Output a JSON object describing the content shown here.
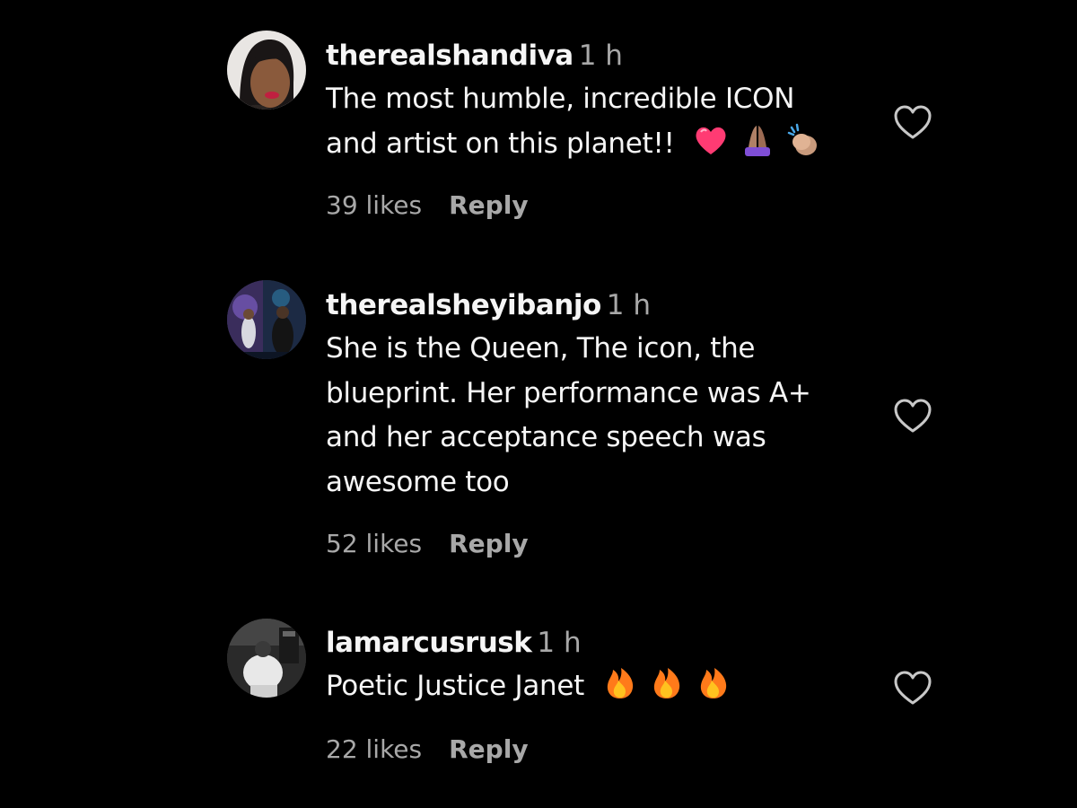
{
  "comments": [
    {
      "username": "therealshandiva",
      "time": "1 h",
      "text_lines": [
        "The most humble, incredible ICON",
        "and artist on this planet!!"
      ],
      "emojis": [
        "heart-emoji",
        "praying-hands-emoji",
        "clapping-hands-emoji"
      ],
      "likes": "39 likes",
      "reply": "Reply"
    },
    {
      "username": "therealsheyibanjo",
      "time": "1 h",
      "text_lines": [
        "She is the Queen, The icon, the",
        "blueprint. Her performance was A+",
        "and her acceptance speech was",
        "awesome too"
      ],
      "likes": "52 likes",
      "reply": "Reply"
    },
    {
      "username": "lamarcusrusk",
      "time": "1 h",
      "text_lines": [
        "Poetic Justice Janet"
      ],
      "emojis": [
        "fire-emoji",
        "fire-emoji",
        "fire-emoji"
      ],
      "likes": "22 likes",
      "reply": "Reply"
    }
  ],
  "icons": {
    "like": "heart-outline-icon"
  },
  "colors": {
    "background": "#000000",
    "primary_text": "#f5f5f5",
    "secondary_text": "#a8a8a8"
  }
}
